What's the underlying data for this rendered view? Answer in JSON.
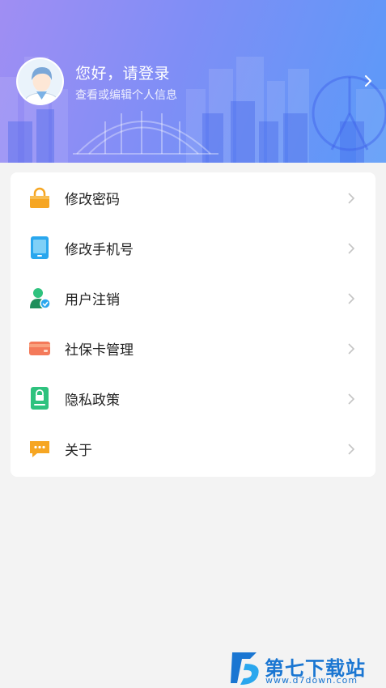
{
  "header": {
    "greeting": "您好，请登录",
    "subtitle": "查看或编辑个人信息"
  },
  "menu": {
    "items": [
      {
        "label": "修改密码",
        "icon": "lock-icon",
        "color": "#f6a623"
      },
      {
        "label": "修改手机号",
        "icon": "phone-icon",
        "color": "#2aa7ee"
      },
      {
        "label": "用户注销",
        "icon": "user-cancel-icon",
        "color": "#2ec27e"
      },
      {
        "label": "社保卡管理",
        "icon": "card-icon",
        "color": "#f47a5a"
      },
      {
        "label": "隐私政策",
        "icon": "privacy-document-icon",
        "color": "#2ec27e"
      },
      {
        "label": "关于",
        "icon": "chat-bubble-icon",
        "color": "#f6a623"
      }
    ]
  },
  "watermark": {
    "title": "第七下载站",
    "url": "www.d7down.com"
  }
}
